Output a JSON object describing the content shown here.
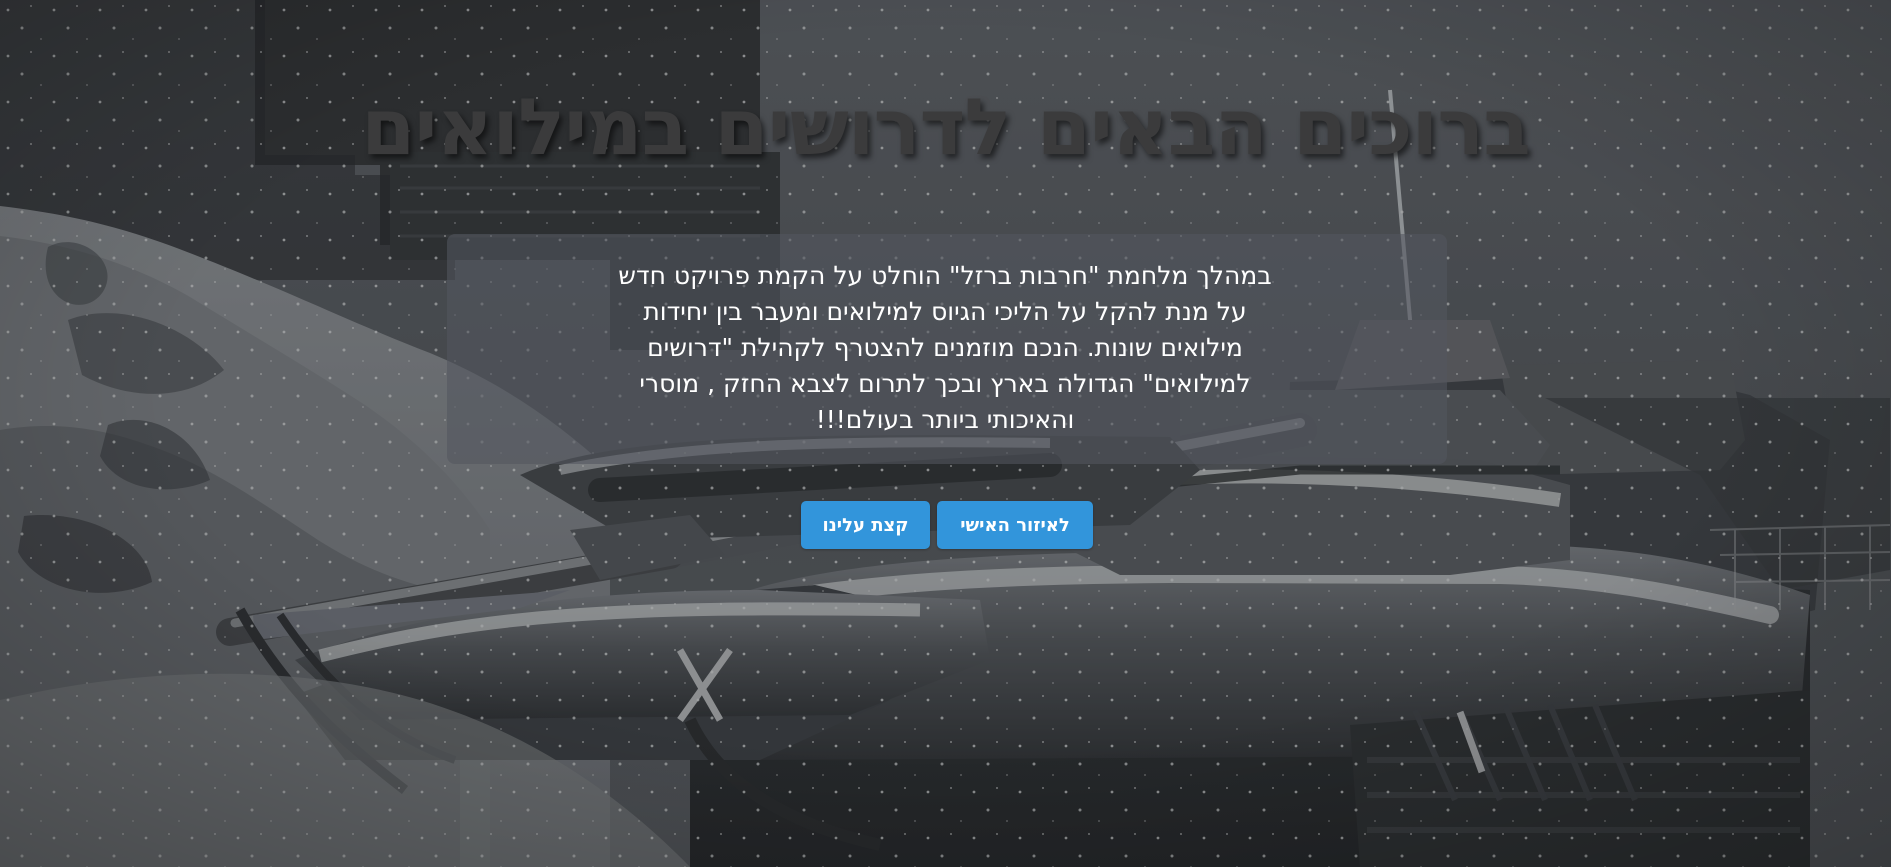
{
  "hero": {
    "title": "ברוכים הבאים לדרושים במילואים",
    "intro_lines": [
      "במהלך מלחמת \"חרבות ברזל\" הוחלט על הקמת פרויקט חדש",
      "על מנת להקל על הליכי הגיוס למילואים ומעבר בין יחידות",
      "מילואים שונות. הנכם מוזמנים להצטרף לקהילת \"דרושים",
      "למילואים\" הגדולה בארץ ובכך לתרום לצבא החזק , מוסרי",
      "והאיכותי ביותר בעולם!!!"
    ]
  },
  "actions": {
    "personal_area_label": "לאיזור האישי",
    "about_label": "קצת עלינו"
  },
  "colors": {
    "button_blue": "#3295db",
    "title_gray": "#3b3b3c",
    "card_overlay": "#52565e"
  },
  "background": {
    "image_description": "snow-covered-tanks-scene"
  }
}
